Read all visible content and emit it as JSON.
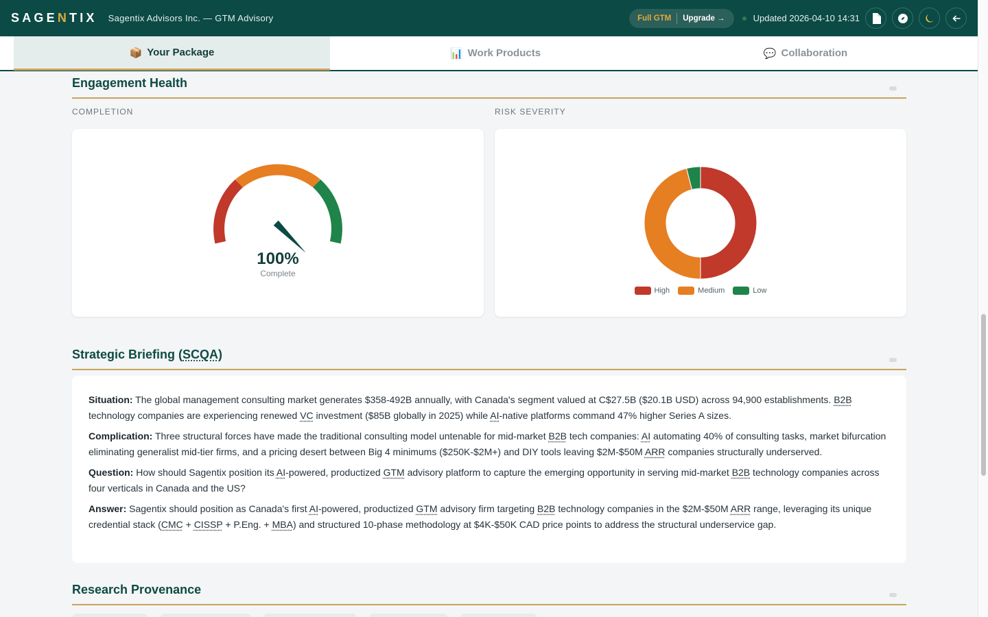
{
  "header": {
    "brand_prefix": "SAGE",
    "brand_accent": "N",
    "brand_suffix": "TIX",
    "subtitle": "Sagentix Advisors Inc. — GTM Advisory",
    "tier": "Full GTM",
    "upgrade": "Upgrade →",
    "updated": "Updated 2026-04-10 14:31",
    "buttons": [
      "document-icon",
      "compass-icon",
      "moon-icon",
      "back-arrow-icon"
    ]
  },
  "tabs": [
    {
      "icon": "📦",
      "label": "Your Package",
      "active": true
    },
    {
      "icon": "📊",
      "label": "Work Products",
      "active": false
    },
    {
      "icon": "💬",
      "label": "Collaboration",
      "active": false
    }
  ],
  "engagement": {
    "title": "Engagement Health",
    "completion_label": "COMPLETION",
    "risk_label": "RISK SEVERITY",
    "completion_value": "100%",
    "completion_sub": "Complete",
    "completion_fraction": 1.0
  },
  "chart_data": {
    "type": "pie",
    "categories": [
      "High",
      "Medium",
      "Low"
    ],
    "values": [
      50,
      46,
      4
    ],
    "colors": [
      "#c0392b",
      "#e67e22",
      "#1e8449"
    ],
    "legend_position": "bottom"
  },
  "briefing": {
    "title_prefix": "Strategic Briefing (",
    "title_abbr": "SCQA",
    "title_suffix": ")",
    "situation_label": "Situation:",
    "complication_label": "Complication:",
    "question_label": "Question:",
    "answer_label": "Answer:"
  },
  "provenance": {
    "title": "Research Provenance"
  },
  "colors": {
    "primary": "#0b4a45",
    "accent": "#c9a15e",
    "high": "#c0392b",
    "medium": "#e67e22",
    "low": "#1e8449"
  }
}
